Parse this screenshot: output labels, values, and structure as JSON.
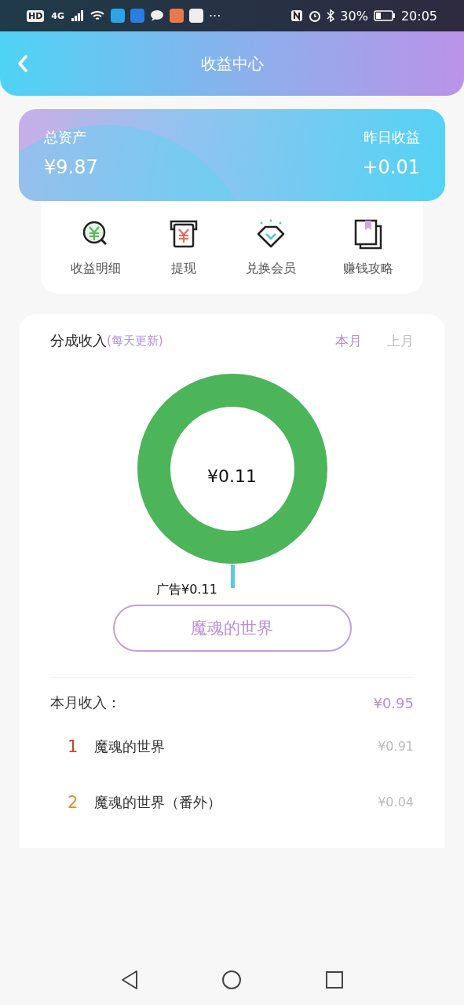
{
  "status_bar": {
    "badges": [
      "HD",
      "4G"
    ],
    "more": "···",
    "battery": "30%",
    "time": "20:05"
  },
  "header": {
    "title": "收益中心"
  },
  "summary": {
    "total_label": "总资产",
    "total_value": "¥9.87",
    "yesterday_label": "昨日收益",
    "yesterday_value": "+0.01"
  },
  "actions": [
    {
      "kind": "detail",
      "label": "收益明细"
    },
    {
      "kind": "withdraw",
      "label": "提现"
    },
    {
      "kind": "diamond",
      "label": "兑换会员"
    },
    {
      "kind": "book",
      "label": "赚钱攻略"
    }
  ],
  "share_income": {
    "title": "分成收入",
    "note": "(每天更新)",
    "tabs": [
      {
        "label": "本月",
        "selected": true
      },
      {
        "label": "上月",
        "selected": false
      }
    ],
    "center_text": "¥0.11",
    "slice_label": "广告¥0.11",
    "work_button": "魔魂的世界"
  },
  "month_income": {
    "label": "本月收入：",
    "total": "¥0.95",
    "rows": [
      {
        "rank": "1",
        "color": "#c8452a",
        "title": "魔魂的世界",
        "amount": "¥0.91"
      },
      {
        "rank": "2",
        "color": "#e08c2c",
        "title": "魔魂的世界（番外）",
        "amount": "¥0.04"
      }
    ]
  }
}
